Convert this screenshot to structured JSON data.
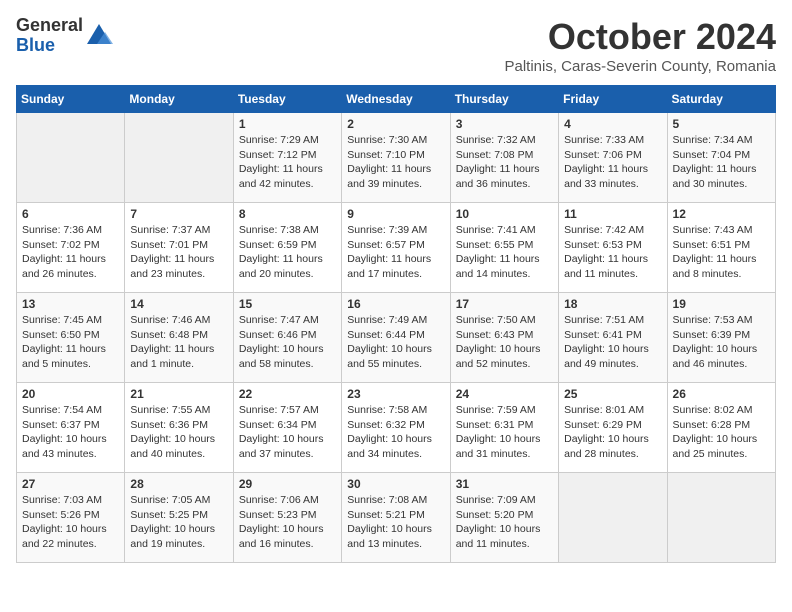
{
  "logo": {
    "general": "General",
    "blue": "Blue"
  },
  "title": "October 2024",
  "location": "Paltinis, Caras-Severin County, Romania",
  "days_header": [
    "Sunday",
    "Monday",
    "Tuesday",
    "Wednesday",
    "Thursday",
    "Friday",
    "Saturday"
  ],
  "weeks": [
    [
      {
        "num": "",
        "info": ""
      },
      {
        "num": "",
        "info": ""
      },
      {
        "num": "1",
        "info": "Sunrise: 7:29 AM\nSunset: 7:12 PM\nDaylight: 11 hours and 42 minutes."
      },
      {
        "num": "2",
        "info": "Sunrise: 7:30 AM\nSunset: 7:10 PM\nDaylight: 11 hours and 39 minutes."
      },
      {
        "num": "3",
        "info": "Sunrise: 7:32 AM\nSunset: 7:08 PM\nDaylight: 11 hours and 36 minutes."
      },
      {
        "num": "4",
        "info": "Sunrise: 7:33 AM\nSunset: 7:06 PM\nDaylight: 11 hours and 33 minutes."
      },
      {
        "num": "5",
        "info": "Sunrise: 7:34 AM\nSunset: 7:04 PM\nDaylight: 11 hours and 30 minutes."
      }
    ],
    [
      {
        "num": "6",
        "info": "Sunrise: 7:36 AM\nSunset: 7:02 PM\nDaylight: 11 hours and 26 minutes."
      },
      {
        "num": "7",
        "info": "Sunrise: 7:37 AM\nSunset: 7:01 PM\nDaylight: 11 hours and 23 minutes."
      },
      {
        "num": "8",
        "info": "Sunrise: 7:38 AM\nSunset: 6:59 PM\nDaylight: 11 hours and 20 minutes."
      },
      {
        "num": "9",
        "info": "Sunrise: 7:39 AM\nSunset: 6:57 PM\nDaylight: 11 hours and 17 minutes."
      },
      {
        "num": "10",
        "info": "Sunrise: 7:41 AM\nSunset: 6:55 PM\nDaylight: 11 hours and 14 minutes."
      },
      {
        "num": "11",
        "info": "Sunrise: 7:42 AM\nSunset: 6:53 PM\nDaylight: 11 hours and 11 minutes."
      },
      {
        "num": "12",
        "info": "Sunrise: 7:43 AM\nSunset: 6:51 PM\nDaylight: 11 hours and 8 minutes."
      }
    ],
    [
      {
        "num": "13",
        "info": "Sunrise: 7:45 AM\nSunset: 6:50 PM\nDaylight: 11 hours and 5 minutes."
      },
      {
        "num": "14",
        "info": "Sunrise: 7:46 AM\nSunset: 6:48 PM\nDaylight: 11 hours and 1 minute."
      },
      {
        "num": "15",
        "info": "Sunrise: 7:47 AM\nSunset: 6:46 PM\nDaylight: 10 hours and 58 minutes."
      },
      {
        "num": "16",
        "info": "Sunrise: 7:49 AM\nSunset: 6:44 PM\nDaylight: 10 hours and 55 minutes."
      },
      {
        "num": "17",
        "info": "Sunrise: 7:50 AM\nSunset: 6:43 PM\nDaylight: 10 hours and 52 minutes."
      },
      {
        "num": "18",
        "info": "Sunrise: 7:51 AM\nSunset: 6:41 PM\nDaylight: 10 hours and 49 minutes."
      },
      {
        "num": "19",
        "info": "Sunrise: 7:53 AM\nSunset: 6:39 PM\nDaylight: 10 hours and 46 minutes."
      }
    ],
    [
      {
        "num": "20",
        "info": "Sunrise: 7:54 AM\nSunset: 6:37 PM\nDaylight: 10 hours and 43 minutes."
      },
      {
        "num": "21",
        "info": "Sunrise: 7:55 AM\nSunset: 6:36 PM\nDaylight: 10 hours and 40 minutes."
      },
      {
        "num": "22",
        "info": "Sunrise: 7:57 AM\nSunset: 6:34 PM\nDaylight: 10 hours and 37 minutes."
      },
      {
        "num": "23",
        "info": "Sunrise: 7:58 AM\nSunset: 6:32 PM\nDaylight: 10 hours and 34 minutes."
      },
      {
        "num": "24",
        "info": "Sunrise: 7:59 AM\nSunset: 6:31 PM\nDaylight: 10 hours and 31 minutes."
      },
      {
        "num": "25",
        "info": "Sunrise: 8:01 AM\nSunset: 6:29 PM\nDaylight: 10 hours and 28 minutes."
      },
      {
        "num": "26",
        "info": "Sunrise: 8:02 AM\nSunset: 6:28 PM\nDaylight: 10 hours and 25 minutes."
      }
    ],
    [
      {
        "num": "27",
        "info": "Sunrise: 7:03 AM\nSunset: 5:26 PM\nDaylight: 10 hours and 22 minutes."
      },
      {
        "num": "28",
        "info": "Sunrise: 7:05 AM\nSunset: 5:25 PM\nDaylight: 10 hours and 19 minutes."
      },
      {
        "num": "29",
        "info": "Sunrise: 7:06 AM\nSunset: 5:23 PM\nDaylight: 10 hours and 16 minutes."
      },
      {
        "num": "30",
        "info": "Sunrise: 7:08 AM\nSunset: 5:21 PM\nDaylight: 10 hours and 13 minutes."
      },
      {
        "num": "31",
        "info": "Sunrise: 7:09 AM\nSunset: 5:20 PM\nDaylight: 10 hours and 11 minutes."
      },
      {
        "num": "",
        "info": ""
      },
      {
        "num": "",
        "info": ""
      }
    ]
  ]
}
